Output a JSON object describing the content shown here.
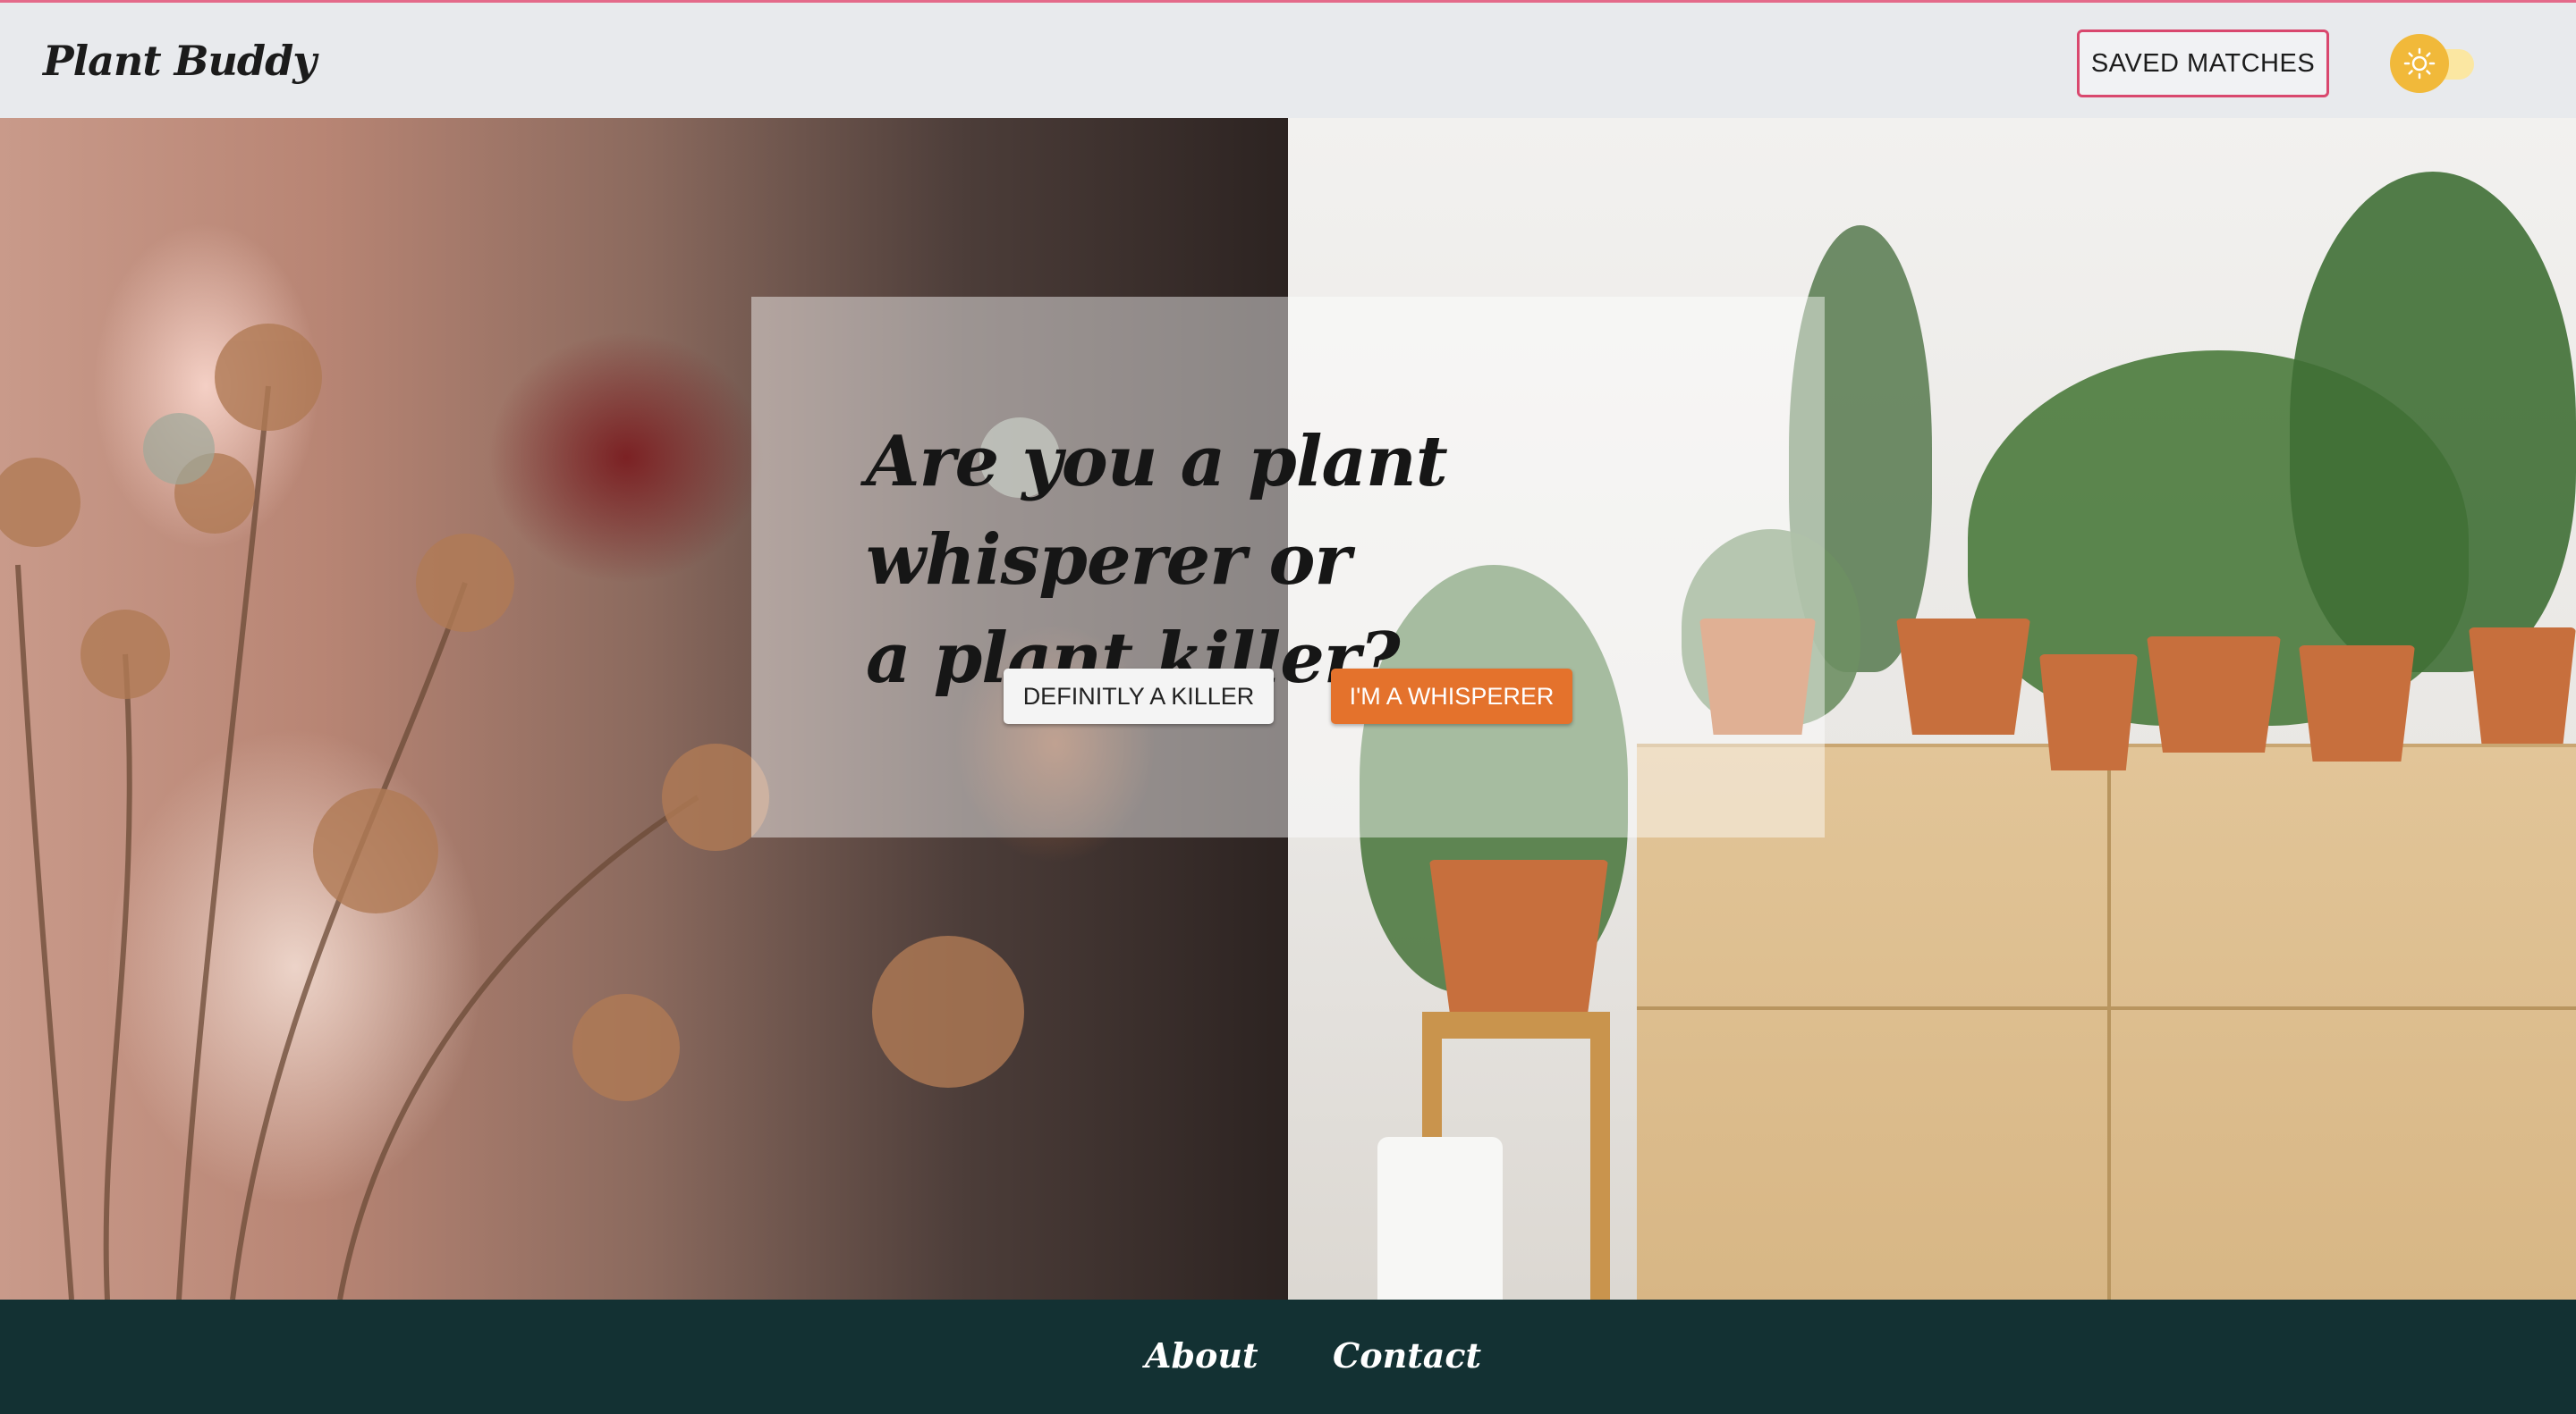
{
  "header": {
    "logo": "Plant Buddy",
    "saved_matches_label": "SAVED MATCHES",
    "theme_toggle_icon": "sun-icon"
  },
  "hero": {
    "headline_line1": "Are you a plant whisperer or",
    "headline_line2": "a plant killer?",
    "killer_button_label": "DEFINITLY A KILLER",
    "whisperer_button_label": "I'M A WHISPERER"
  },
  "footer": {
    "about_label": "About",
    "contact_label": "Contact"
  },
  "colors": {
    "header_bg": "#e8eaed",
    "saved_border": "#d9486e",
    "whisperer_accent": "#e4722c",
    "footer_bg": "#133133",
    "toggle_knob": "#f1b93a"
  }
}
